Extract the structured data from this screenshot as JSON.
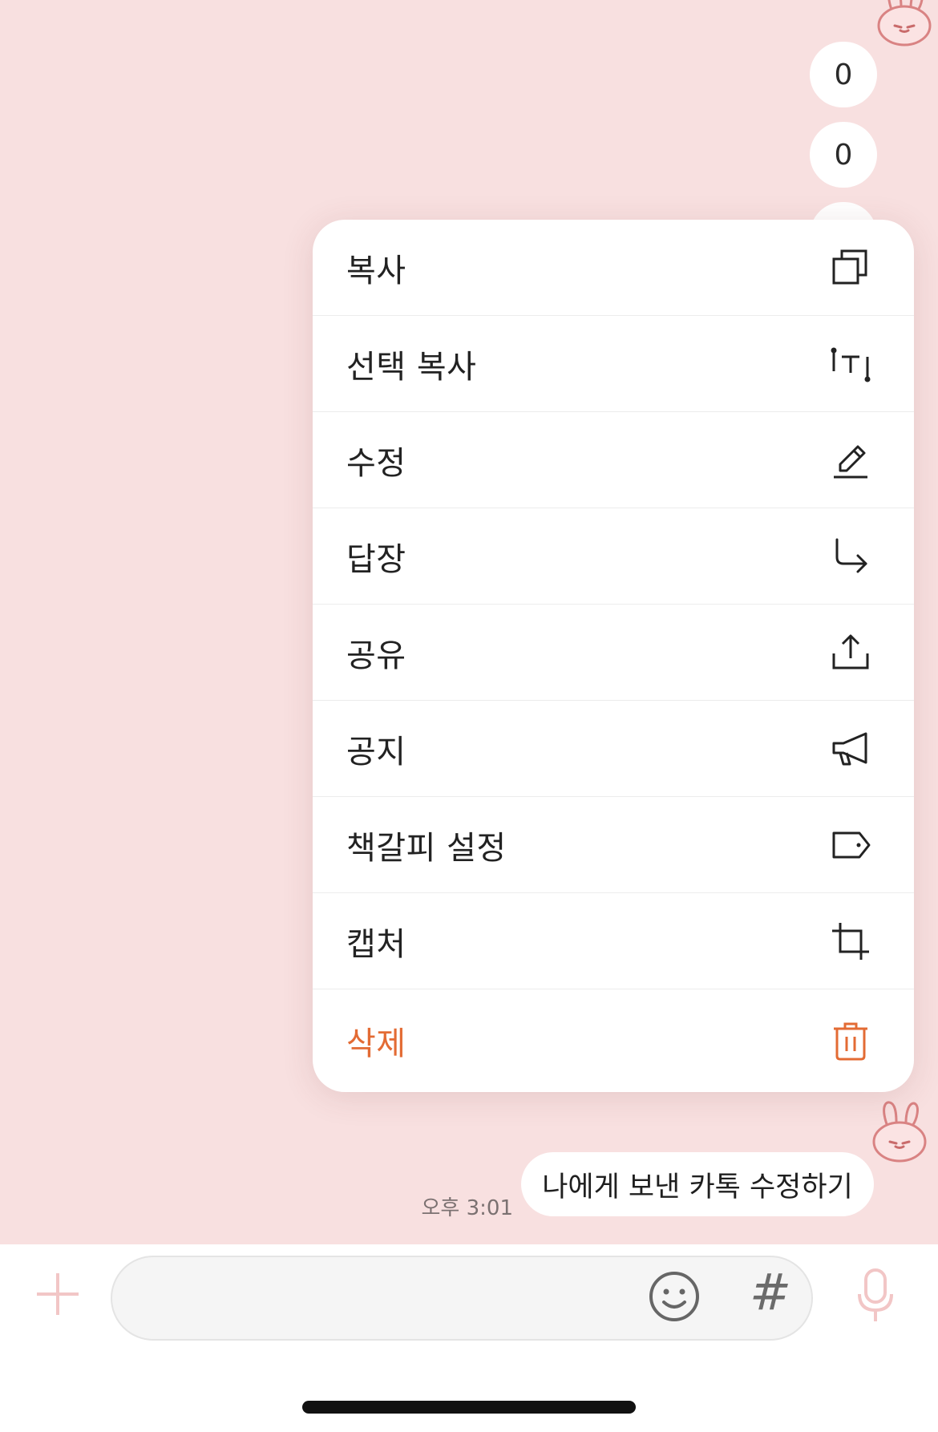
{
  "chat": {
    "bubbles": [
      "0",
      "0"
    ],
    "message": {
      "text": "나에게 보낸 카톡 수정하기",
      "time": "오후 3:01"
    }
  },
  "context_menu": {
    "items": [
      {
        "label": "복사",
        "icon": "copy-icon"
      },
      {
        "label": "선택 복사",
        "icon": "select-text-icon"
      },
      {
        "label": "수정",
        "icon": "pencil-icon"
      },
      {
        "label": "답장",
        "icon": "reply-arrow-icon"
      },
      {
        "label": "공유",
        "icon": "share-icon"
      },
      {
        "label": "공지",
        "icon": "megaphone-icon"
      },
      {
        "label": "책갈피 설정",
        "icon": "tag-icon"
      },
      {
        "label": "캡처",
        "icon": "crop-icon"
      },
      {
        "label": "삭제",
        "icon": "trash-icon",
        "danger": true
      }
    ]
  },
  "input_bar": {
    "hash_label": "#"
  },
  "colors": {
    "chat_background": "#f8e0e0",
    "danger": "#e36b34",
    "bunny": "#d98383"
  }
}
